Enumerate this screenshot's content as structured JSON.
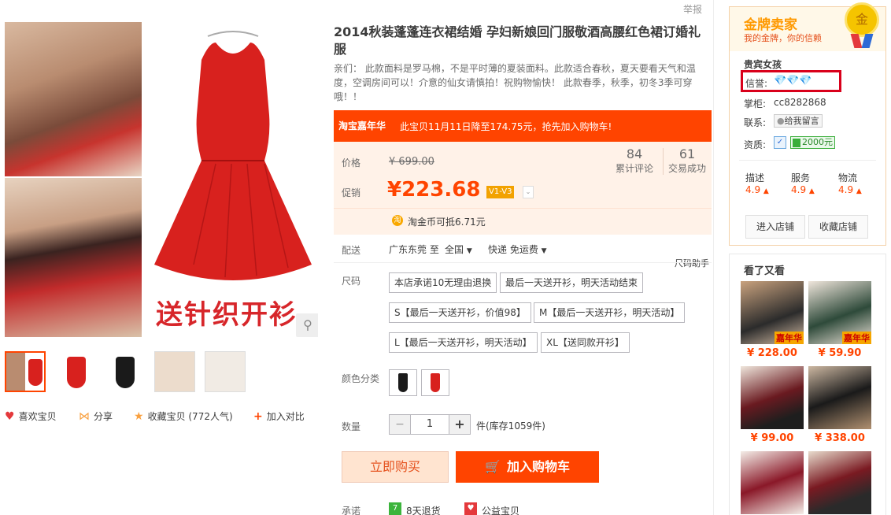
{
  "report": "举报",
  "product": {
    "title": "2014秋装蓬蓬连衣裙结婚 孕妇新娘回门服敬酒高腰红色裙订婚礼服",
    "subtitle": "亲们： 此款面料是罗马棉，不是平时薄的夏装面料。此款适合春秋，夏天要看天气和温度，空调房间可以！介意的仙女请慎拍！祝购物愉快！ 此款春季，秋季，初冬3季可穿哦！！",
    "image_promo": "送针织开衫",
    "banner_logo": "淘宝嘉年华",
    "banner_text": "此宝贝11月11日降至174.75元，抢先加入购物车!",
    "price_label": "价格",
    "original_price": "¥ 699.00",
    "promo_label": "促销",
    "promo_price": "¥223.68",
    "vip_badge": "V1-V3",
    "reviews_count": "84",
    "reviews_label": "累计评论",
    "deals_count": "61",
    "deals_label": "交易成功",
    "taojinbi": "淘金币可抵6.71元",
    "shipping_label": "配送",
    "shipping_from": "广东东莞 至",
    "shipping_to": "全国",
    "shipping_method": "快递 免运费",
    "size_helper": "尺码助手",
    "size_label": "尺码",
    "size_options": [
      "本店承诺10无理由退换",
      "最后一天送开衫，明天活动结束",
      "S【最后一天送开衫，价值98】",
      "M【最后一天送开衫，明天活动】",
      "L【最后一天送开衫，明天活动】",
      "XL【送同款开衫】"
    ],
    "color_label": "颜色分类",
    "quantity_label": "数量",
    "quantity_minus": "−",
    "quantity_value": "1",
    "quantity_plus": "+",
    "stock": "件(库存1059件)",
    "buy_now": "立即购买",
    "add_cart": "加入购物车",
    "promise_label": "承诺",
    "promise_return": "8天退货",
    "promise_charity": "公益宝贝"
  },
  "actions": {
    "like": "喜欢宝贝",
    "share": "分享",
    "collect": "收藏宝贝 (772人气)",
    "compare": "加入对比"
  },
  "seller": {
    "title": "金牌卖家",
    "subtitle": "我的金牌，你的信赖",
    "medal": "金",
    "name": "贵宾女孩",
    "credit_label": "信誉:",
    "keeper_label": "掌柜:",
    "keeper": "cc8282868",
    "contact_label": "联系:",
    "contact_btn": "给我留言",
    "qual_label": "资质:",
    "deposit": "2000元",
    "scores": [
      {
        "label": "描述",
        "value": "4.9"
      },
      {
        "label": "服务",
        "value": "4.9"
      },
      {
        "label": "物流",
        "value": "4.9"
      }
    ],
    "enter_shop": "进入店铺",
    "fav_shop": "收藏店铺"
  },
  "also_viewed": {
    "title": "看了又看",
    "badge": "嘉年华",
    "items": [
      {
        "price": "¥ 228.00"
      },
      {
        "price": "¥ 59.90"
      },
      {
        "price": "¥ 99.00"
      },
      {
        "price": "¥ 338.00"
      }
    ]
  },
  "colors": {
    "accent": "#ff4400",
    "price_bg": "#fff2e8",
    "highlight_box": "#d9001b"
  }
}
